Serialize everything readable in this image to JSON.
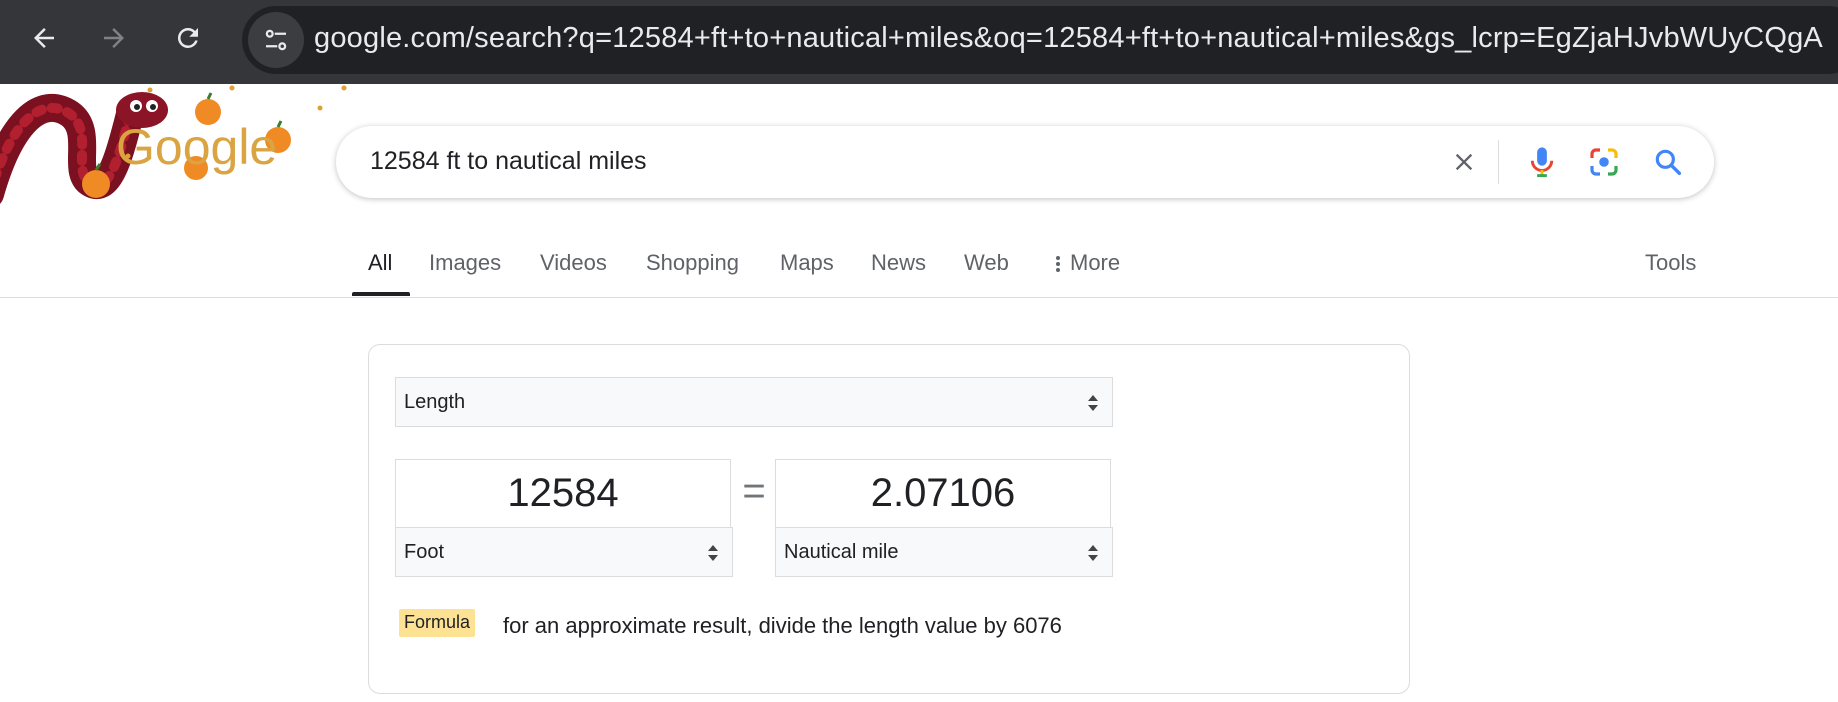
{
  "browser": {
    "url": "google.com/search?q=12584+ft+to+nautical+miles&oq=12584+ft+to+nautical+miles&gs_lcrp=EgZjaHJvbWUyCQgA",
    "back_icon": "arrow-left-icon",
    "forward_icon": "arrow-right-icon",
    "reload_icon": "reload-icon",
    "site_info_icon": "tune-icon"
  },
  "doodle": {
    "alt": "Google"
  },
  "search": {
    "query": "12584 ft to nautical miles",
    "icons": [
      "close-icon",
      "mic-icon",
      "lens-icon",
      "search-icon"
    ]
  },
  "tabs": [
    {
      "label": "All",
      "active": true
    },
    {
      "label": "Images"
    },
    {
      "label": "Videos"
    },
    {
      "label": "Shopping"
    },
    {
      "label": "Maps"
    },
    {
      "label": "News"
    },
    {
      "label": "Web"
    },
    {
      "label": "More"
    }
  ],
  "tools_label": "Tools",
  "converter": {
    "quantity": "Length",
    "from_value": "12584",
    "from_unit": "Foot",
    "equals": "=",
    "to_value": "2.07106",
    "to_unit": "Nautical mile",
    "formula_label": "Formula",
    "formula_text": "for an approximate result, divide the length value by 6076"
  },
  "colors": {
    "chrome_bg": "#35363a",
    "omnibox_bg": "#202124",
    "google_blue": "#4285f4",
    "google_red": "#ea4335",
    "google_yellow": "#fbbc04",
    "google_green": "#34a853",
    "formula_highlight": "#fde293"
  }
}
